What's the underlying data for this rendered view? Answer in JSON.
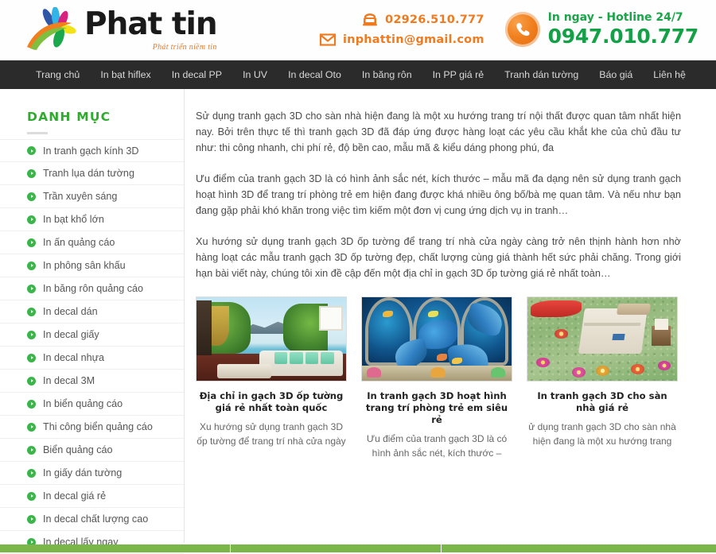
{
  "header": {
    "logo_word": "Phat tin",
    "logo_slogan": "Phát triển niềm tin",
    "phone": "02926.510.777",
    "email": "inphattin@gmail.com",
    "hotline_label": "In ngay - Hotline 24/7",
    "hotline_number": "0947.010.777",
    "phone_icon": "telephone-icon",
    "email_icon": "envelope-icon",
    "hotline_icon": "phone-handset-icon"
  },
  "nav": {
    "items": [
      {
        "label": "Trang chủ"
      },
      {
        "label": "In bạt hiflex"
      },
      {
        "label": "In decal PP"
      },
      {
        "label": "In UV"
      },
      {
        "label": "In decal Oto"
      },
      {
        "label": "In băng rôn"
      },
      {
        "label": "In PP giá rẻ"
      },
      {
        "label": "Tranh dán tường"
      },
      {
        "label": "Báo giá"
      },
      {
        "label": "Liên hệ"
      }
    ]
  },
  "sidebar": {
    "title": "DANH MỤC",
    "items": [
      {
        "label": "In tranh gạch kính 3D"
      },
      {
        "label": "Tranh lụa dán tường"
      },
      {
        "label": "Trần xuyên sáng"
      },
      {
        "label": "In bạt khổ lớn"
      },
      {
        "label": "In ấn quảng cáo"
      },
      {
        "label": "In phông sân khấu"
      },
      {
        "label": "In băng rôn quảng cáo"
      },
      {
        "label": "In decal dán"
      },
      {
        "label": "In decal giấy"
      },
      {
        "label": "In decal nhựa"
      },
      {
        "label": "In decal 3M"
      },
      {
        "label": "In biển quảng cáo"
      },
      {
        "label": "Thi công biển quảng cáo"
      },
      {
        "label": "Biển quảng cáo"
      },
      {
        "label": "In giấy dán tường"
      },
      {
        "label": "In decal giá rẻ"
      },
      {
        "label": "In decal chất lượng cao"
      },
      {
        "label": "In decal lấy ngay"
      }
    ]
  },
  "main": {
    "paragraphs": [
      "Sử dụng tranh gạch 3D cho sàn nhà hiện đang là một xu hướng trang trí nội thất được quan tâm nhất hiện nay. Bởi trên thực tế thì tranh gạch 3D đã đáp ứng được hàng loạt các yêu cầu khắt khe của chủ đầu tư như: thi công nhanh, chi phí rẻ, độ bền cao, mẫu mã & kiểu dáng phong phú, đa",
      "Ưu điểm của tranh gạch 3D là có hình ảnh sắc nét, kích thước – mẫu mã đa dạng nên sử dụng tranh gạch hoạt hình 3D để trang trí phòng trẻ em hiện đang được khá nhiều ông bố/bà mẹ quan tâm. Và nếu như bạn đang gặp phải khó khăn trong việc tìm kiếm một đơn vị cung ứng dịch vụ in tranh…",
      "Xu hướng sử dụng tranh gạch 3D ốp tường để trang trí nhà cửa ngày càng trở nên thịnh hành hơn nhờ hàng loạt các mẫu tranh gạch 3D ốp tường đẹp, chất lượng cùng giá thành hết sức phải chăng. Trong giới hạn bài viết này, chúng tôi xin đề cập đến một địa chỉ in gạch 3D ốp tường giá rẻ nhất toàn…"
    ],
    "cards": [
      {
        "image_alt": "living-room-nature-mural-thumbnail",
        "title": "Địa chỉ in gạch 3D ốp tường giá rẻ nhất toàn quốc",
        "excerpt": "Xu hướng sử dụng tranh gạch 3D ốp tường để trang trí nhà cửa ngày"
      },
      {
        "image_alt": "underwater-dolphins-3d-mural-thumbnail",
        "title": "In tranh gạch 3D hoạt hình trang trí phòng trẻ em siêu rẻ",
        "excerpt": "Ưu điểm của tranh gạch 3D là có hình ảnh sắc nét, kích thước –"
      },
      {
        "image_alt": "bedroom-flower-floor-3d-thumbnail",
        "title": "In tranh gạch 3D cho sàn nhà giá rẻ",
        "excerpt": "ử dụng tranh gạch 3D cho sàn nhà hiện đang là một xu hướng trang"
      }
    ]
  },
  "colors": {
    "brand_green": "#2fab2f",
    "accent_orange": "#ef7b21",
    "hotline_green": "#14a046",
    "nav_background": "#2b2b2b",
    "footer_green": "#7ab648"
  }
}
